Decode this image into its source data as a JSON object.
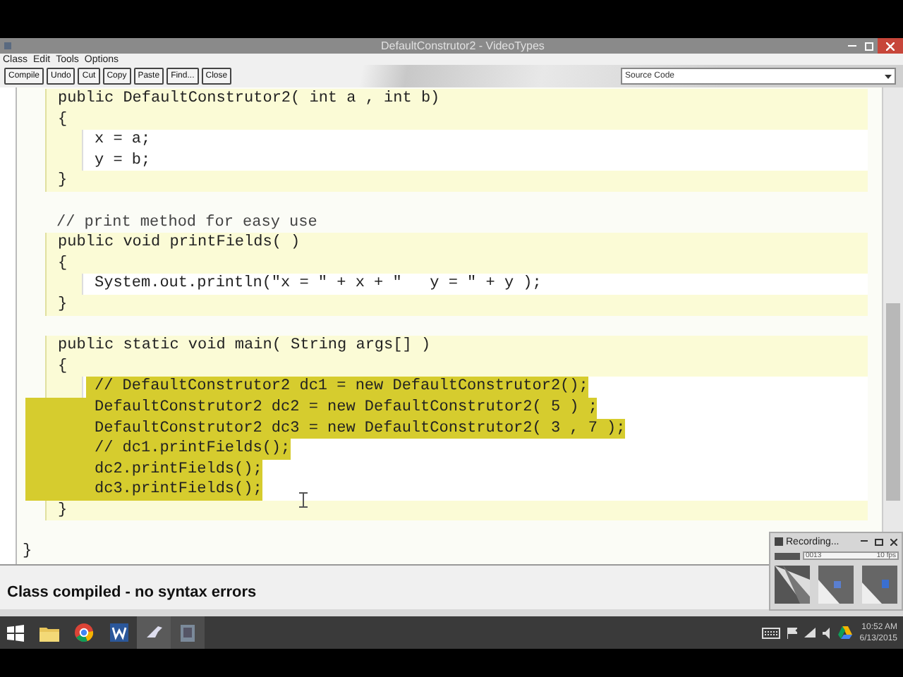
{
  "window": {
    "title": "DefaultConstrutor2 - VideoTypes"
  },
  "menu": [
    "Class",
    "Edit",
    "Tools",
    "Options"
  ],
  "toolbar": [
    "Compile",
    "Undo",
    "Cut",
    "Copy",
    "Paste",
    "Find...",
    "Close"
  ],
  "view_select": {
    "value": "Source Code"
  },
  "code": [
    {
      "kind": "method",
      "header": "public DefaultConstrutor2( int a , int b)",
      "open": "{",
      "body": [
        {
          "text": "x = a;",
          "selected": false
        },
        {
          "text": "y = b;",
          "selected": false
        }
      ],
      "close": "}"
    },
    {
      "kind": "comment",
      "text": "// print method for easy use"
    },
    {
      "kind": "method",
      "header": "public void printFields( )",
      "open": "{",
      "body": [
        {
          "text": "System.out.println(\"x = \" + x + \"   y = \" + y );",
          "selected": false
        }
      ],
      "close": "}"
    },
    {
      "kind": "method",
      "header": "public static void main( String args[] )",
      "open": "{",
      "body": [
        {
          "text": "// DefaultConstrutor2 dc1 = new DefaultConstrutor2();",
          "selected": true
        },
        {
          "text": "DefaultConstrutor2 dc2 = new DefaultConstrutor2( 5 ) ;",
          "selected": true
        },
        {
          "text": "DefaultConstrutor2 dc3 = new DefaultConstrutor2( 3 , 7 );",
          "selected": true
        },
        {
          "text": "// dc1.printFields();",
          "selected": true
        },
        {
          "text": "dc2.printFields();",
          "selected": true
        },
        {
          "text": "dc3.printFields();",
          "selected": true
        }
      ],
      "close": "}"
    },
    {
      "kind": "class_close",
      "text": "}"
    }
  ],
  "status_bar": "Class compiled - no syntax errors",
  "recorder": {
    "title": "Recording...",
    "time": "0013",
    "rate": "10 fps"
  },
  "clock": {
    "time": "10:52 AM",
    "date": "6/13/2015"
  }
}
